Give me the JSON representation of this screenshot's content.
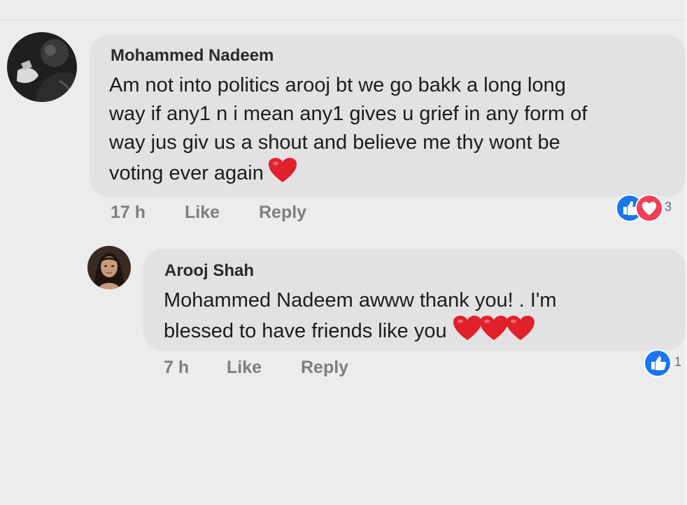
{
  "comments": [
    {
      "author": "Mohammed Nadeem",
      "avatar_icon": "profile-photo-man",
      "lines": [
        "Am not into politics arooj bt we go bakk a long long",
        "way if any1 n i mean any1 gives u grief in any form of",
        "way jus giv us a shout and believe me thy wont be",
        "voting ever again"
      ],
      "emoji": [
        "red-heart"
      ],
      "time": "17 h",
      "like_label": "Like",
      "reply_label": "Reply",
      "reaction_icons": [
        "like-icon",
        "love-icon"
      ],
      "reaction_count": "3"
    },
    {
      "author": "Arooj Shah",
      "avatar_icon": "profile-photo-woman",
      "lines": [
        "Mohammed Nadeem awww thank you! . I'm",
        "blessed to have friends like you"
      ],
      "emoji": [
        "red-heart",
        "red-heart",
        "red-heart"
      ],
      "time": "7 h",
      "like_label": "Like",
      "reply_label": "Reply",
      "reaction_icons": [
        "like-icon"
      ],
      "reaction_count": "1"
    }
  ],
  "colors": {
    "background": "#ececec",
    "bubble": "#e2e2e4",
    "like_blue": "#1877f2",
    "love_red": "#f33e58",
    "meta_gray": "#7c7e82"
  }
}
